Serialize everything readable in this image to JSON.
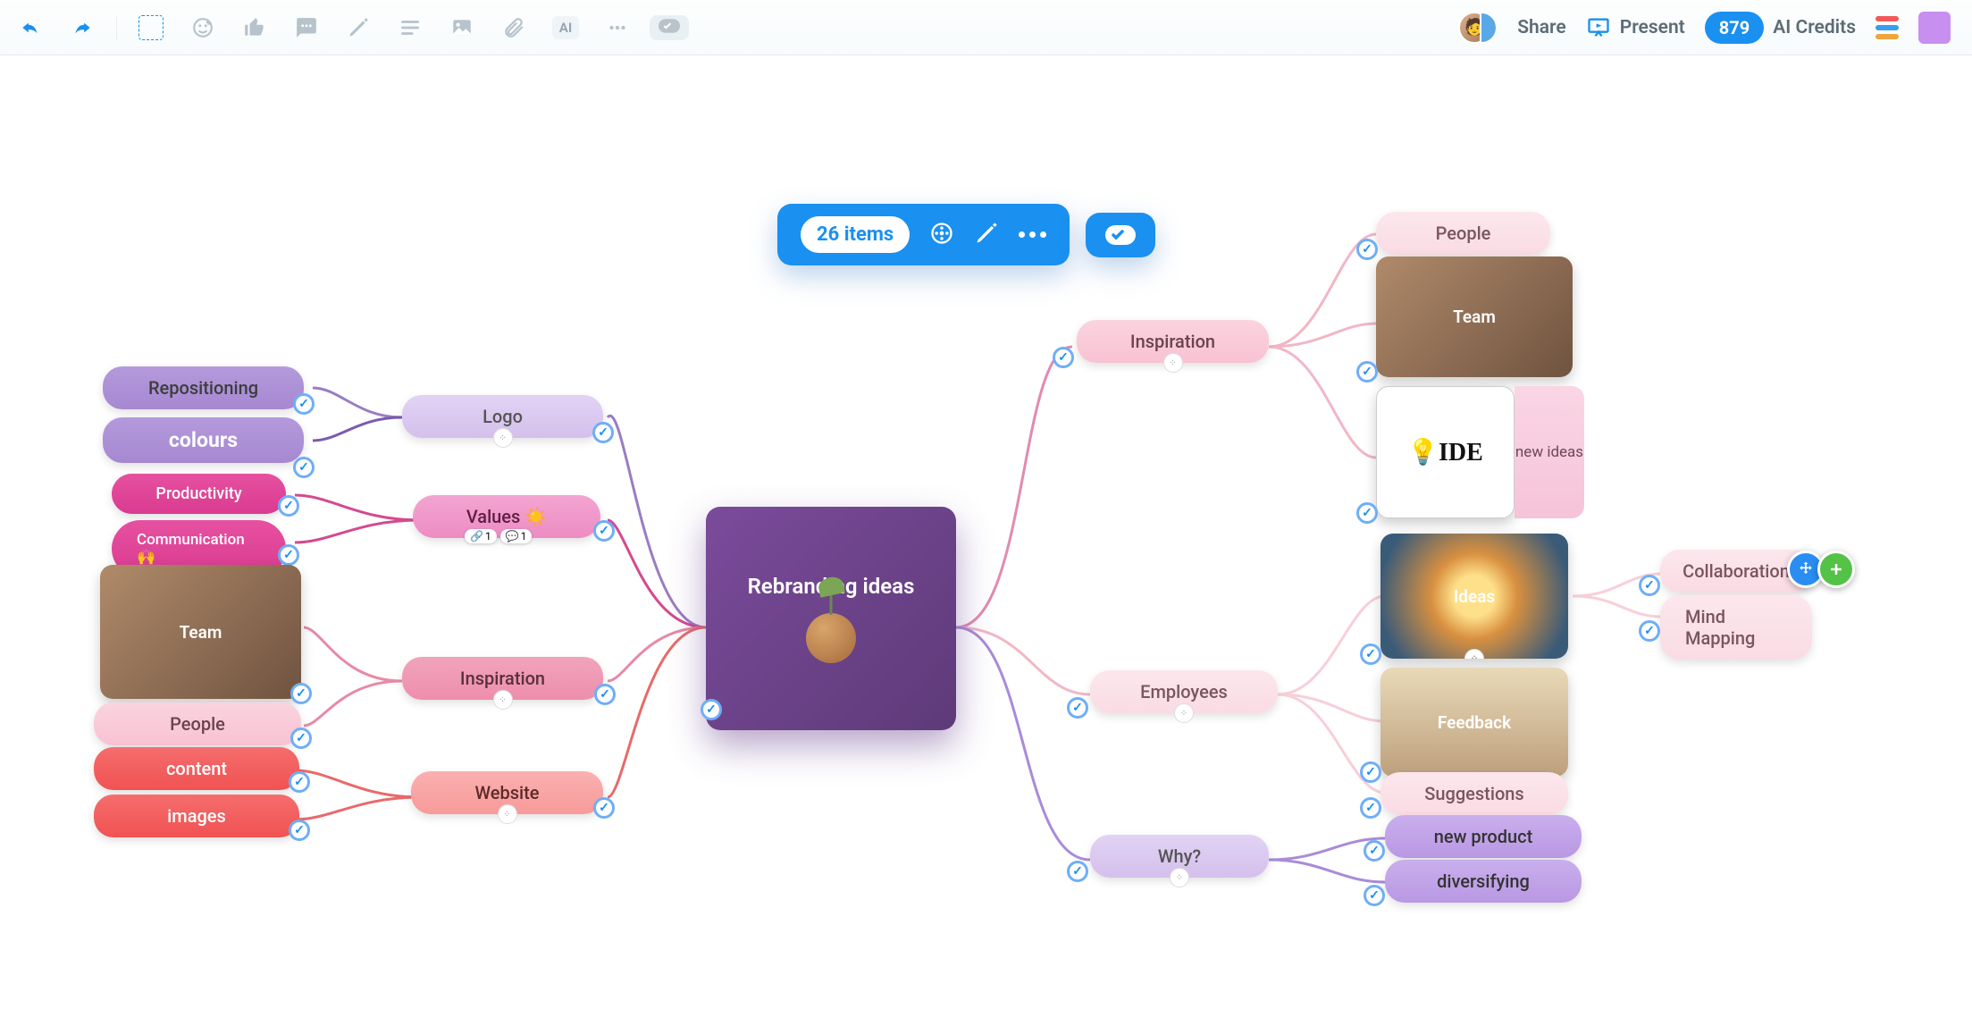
{
  "toolbar": {
    "share_label": "Share",
    "present_label": "Present",
    "credits_label": "AI Credits",
    "credits_count": "879",
    "ai_label": "AI"
  },
  "selection_bar": {
    "count_label": "26 items"
  },
  "central": {
    "title": "Rebranding ideas"
  },
  "left": {
    "logo": {
      "label": "Logo",
      "repositioning": "Repositioning",
      "colours": "colours"
    },
    "values": {
      "label": "Values ☀️",
      "productivity": "Productivity",
      "communication": "Communication 🙌",
      "badge1": "1",
      "badge2": "1"
    },
    "inspiration": {
      "label": "Inspiration",
      "team": "Team",
      "people": "People"
    },
    "website": {
      "label": "Website",
      "content": "content",
      "images": "images"
    }
  },
  "right": {
    "inspiration": {
      "label": "Inspiration",
      "people": "People",
      "team": "Team",
      "newideas": "new ideas"
    },
    "employees": {
      "label": "Employees",
      "ideas": "Ideas",
      "feedback": "Feedback",
      "suggestions": "Suggestions",
      "collaboration": "Collaboration",
      "mindmapping": "Mind Mapping"
    },
    "why": {
      "label": "Why?",
      "newproduct": "new product",
      "diversifying": "diversifying"
    }
  }
}
